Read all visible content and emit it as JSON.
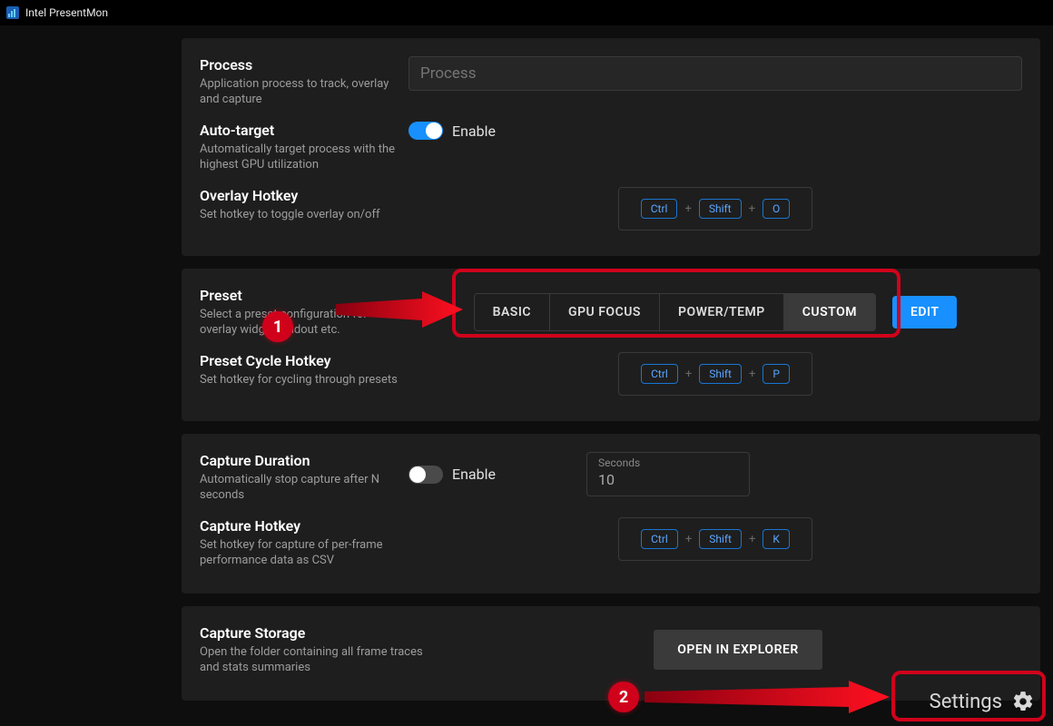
{
  "titlebar": {
    "title": "Intel PresentMon"
  },
  "process": {
    "title": "Process",
    "desc": "Application process to track, overlay and capture",
    "placeholder": "Process"
  },
  "autotarget": {
    "title": "Auto-target",
    "desc": "Automatically target process with the highest GPU utilization",
    "toggle_label": "Enable",
    "enabled": true
  },
  "overlay_hotkey": {
    "title": "Overlay Hotkey",
    "desc": "Set hotkey to toggle overlay on/off",
    "keys": [
      "Ctrl",
      "Shift",
      "O"
    ]
  },
  "preset": {
    "title": "Preset",
    "desc": "Select a preset configuration for overlay widget loadout etc.",
    "options": [
      "BASIC",
      "GPU FOCUS",
      "POWER/TEMP",
      "CUSTOM"
    ],
    "selected": "CUSTOM",
    "edit_label": "EDIT"
  },
  "preset_hotkey": {
    "title": "Preset Cycle Hotkey",
    "desc": "Set hotkey for cycling through presets",
    "keys": [
      "Ctrl",
      "Shift",
      "P"
    ]
  },
  "capture_duration": {
    "title": "Capture Duration",
    "desc": "Automatically stop capture after N seconds",
    "toggle_label": "Enable",
    "enabled": false,
    "seconds_label": "Seconds",
    "seconds_value": "10"
  },
  "capture_hotkey": {
    "title": "Capture Hotkey",
    "desc": "Set hotkey for capture of per-frame performance data as CSV",
    "keys": [
      "Ctrl",
      "Shift",
      "K"
    ]
  },
  "capture_storage": {
    "title": "Capture Storage",
    "desc": "Open the folder containing all frame traces and stats summaries",
    "button": "OPEN IN EXPLORER"
  },
  "footer": {
    "settings": "Settings"
  },
  "annotations": {
    "marker1": "1",
    "marker2": "2"
  }
}
